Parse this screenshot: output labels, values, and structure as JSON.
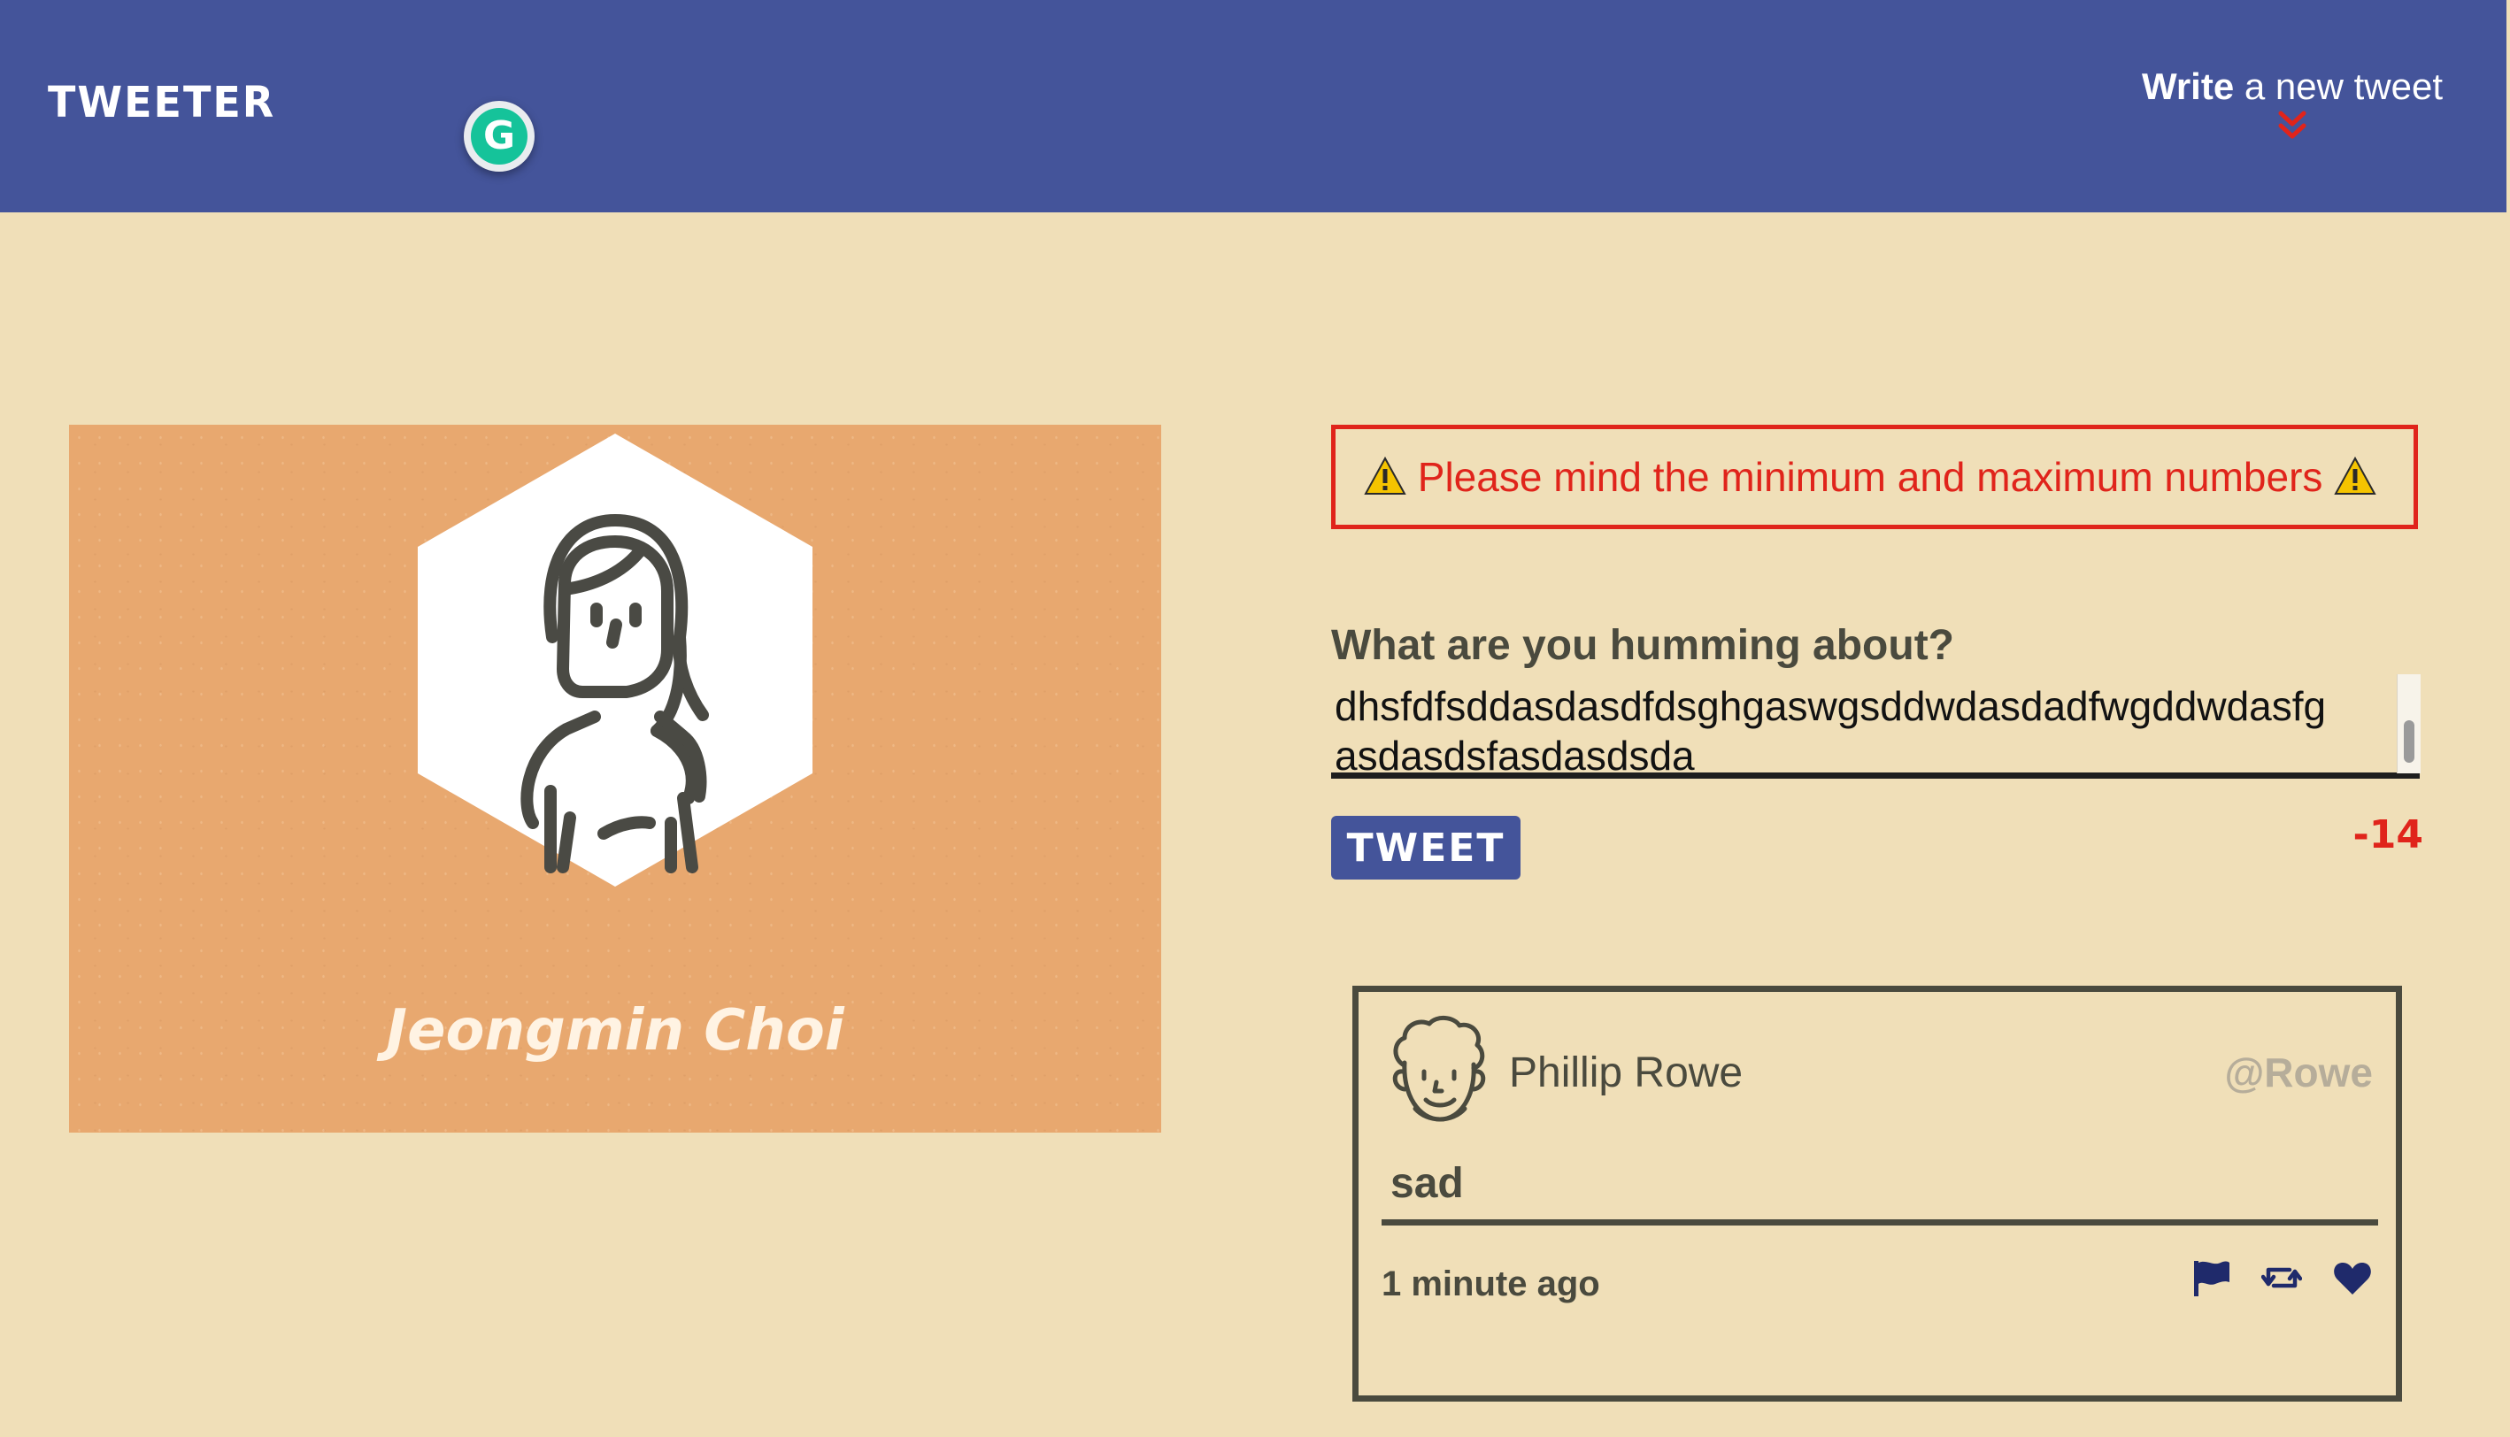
{
  "nav": {
    "brand": "TWEETER",
    "compose_toggle_bold": "Write",
    "compose_toggle_rest": " a new tweet"
  },
  "grammarly": {
    "glyph": "G",
    "icon": "grammarly-icon"
  },
  "profile": {
    "name": "Jeongmin Choi",
    "avatar_icon": "woman-avatar-icon",
    "card_color": "#e8a86f"
  },
  "error": {
    "message": "Please mind the minimum and maximum numbers",
    "icon": "warning-icon",
    "color": "#e0241b"
  },
  "compose": {
    "label": "What are you humming about?",
    "text_value": "dhsfdfsddasdasdfdsghgaswgsddwdasdadfwgddwdasfg asdasdsfasdasdsda",
    "submit_label": "TWEET",
    "counter": "-14"
  },
  "tweet": {
    "author_name": "Phillip Rowe",
    "author_handle": "@Rowe",
    "avatar_icon": "man-avatar-icon",
    "content": "sad",
    "timestamp": "1 minute ago",
    "actions": [
      "flag-icon",
      "retweet-icon",
      "heart-icon"
    ]
  },
  "colors": {
    "nav_bg": "#44549a",
    "page_bg": "#f0dfb8",
    "text_dark": "#4a4a3e",
    "accent_red": "#e0241b",
    "icon_navy": "#1f2a6b"
  }
}
